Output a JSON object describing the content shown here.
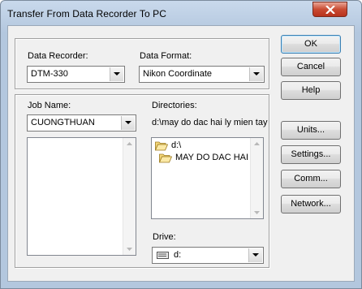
{
  "window": {
    "title": "Transfer From Data Recorder To PC"
  },
  "recorder": {
    "label": "Data Recorder:",
    "value": "DTM-330"
  },
  "format": {
    "label": "Data Format:",
    "value": "Nikon Coordinate"
  },
  "job": {
    "label": "Job Name:",
    "value": "CUONGTHUAN"
  },
  "directories": {
    "label": "Directories:",
    "path": "d:\\may do dac hai ly mien tay",
    "items": [
      "d:\\",
      "MAY DO DAC HAI"
    ]
  },
  "drive": {
    "label": "Drive:",
    "value": "d:"
  },
  "buttons": {
    "ok": "OK",
    "cancel": "Cancel",
    "help": "Help",
    "units": "Units...",
    "settings": "Settings...",
    "comm": "Comm...",
    "network": "Network..."
  },
  "icons": {
    "close": "close-icon",
    "folder": "folder-icon",
    "drive": "drive-icon",
    "dropdown": "chevron-down-icon"
  }
}
